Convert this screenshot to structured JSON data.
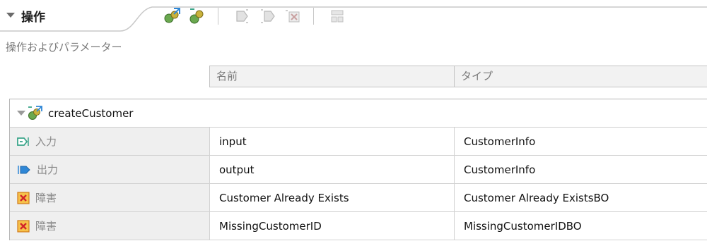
{
  "section": {
    "title": "操作",
    "subtitle": "操作およびパラメーター"
  },
  "toolbar": {
    "buttons": [
      "add-operation-icon",
      "add-request-response-icon",
      "add-input-icon",
      "add-output-icon",
      "add-fault-icon",
      "show-bindings-icon"
    ]
  },
  "columns": {
    "name": "名前",
    "type": "タイプ"
  },
  "operation": {
    "name": "createCustomer",
    "parameters": [
      {
        "kind": "入力",
        "icon": "input-icon",
        "name": "input",
        "type": "CustomerInfo"
      },
      {
        "kind": "出力",
        "icon": "output-icon",
        "name": "output",
        "type": "CustomerInfo"
      },
      {
        "kind": "障害",
        "icon": "fault-icon",
        "name": "Customer Already Exists",
        "type": "Customer Already ExistsBO"
      },
      {
        "kind": "障害",
        "icon": "fault-icon",
        "name": "MissingCustomerID",
        "type": "MissingCustomerIDBO"
      }
    ]
  },
  "colors": {
    "header_bg": "#f2f2f2",
    "kind_bg": "#efefef",
    "fault_orange": "#f08a24",
    "io_teal": "#3aa58a",
    "io_blue": "#2f87d6"
  }
}
